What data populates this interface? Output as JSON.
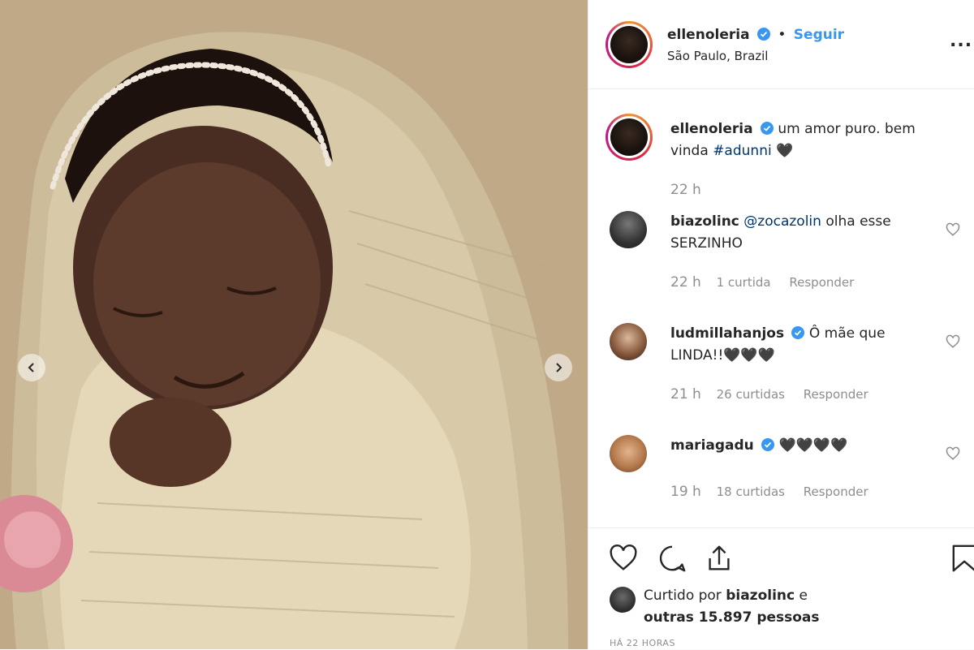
{
  "post": {
    "author": "ellenoleria",
    "follow_label": "Seguir",
    "separator": "•",
    "location": "São Paulo, Brazil",
    "more_label": "...",
    "caption": {
      "username": "ellenoleria",
      "text": "um amor puro. bem vinda",
      "hashtag": "#adunni",
      "emoji": "🖤",
      "time": "22 h"
    },
    "comments": [
      {
        "username": "biazolinc",
        "mention": "@zocazolin",
        "text": "olha esse SERZINHO",
        "time": "22 h",
        "likes": "1 curtida",
        "reply": "Responder",
        "verified": false
      },
      {
        "username": "ludmillahanjos",
        "mention": "",
        "text": "Ô mãe que LINDA!!🖤🖤🖤",
        "time": "21 h",
        "likes": "26 curtidas",
        "reply": "Responder",
        "verified": true
      },
      {
        "username": "mariagadu",
        "mention": "",
        "text": "🖤🖤🖤🖤",
        "time": "19 h",
        "likes": "18 curtidas",
        "reply": "Responder",
        "verified": true
      }
    ],
    "liked_by": {
      "prefix": "Curtido por",
      "username": "biazolinc",
      "connector": "e",
      "others": "outras 15.897 pessoas"
    },
    "timestamp": "HÁ 22 HORAS"
  },
  "colors": {
    "link_blue": "#3897f0",
    "hashtag_blue": "#003569",
    "muted": "#8e8e8e",
    "verified": "#3897f0"
  },
  "icons": [
    "chevron-left-icon",
    "chevron-right-icon",
    "verified-icon",
    "more-icon",
    "heart-outline-icon",
    "comment-icon",
    "share-icon",
    "bookmark-icon"
  ]
}
